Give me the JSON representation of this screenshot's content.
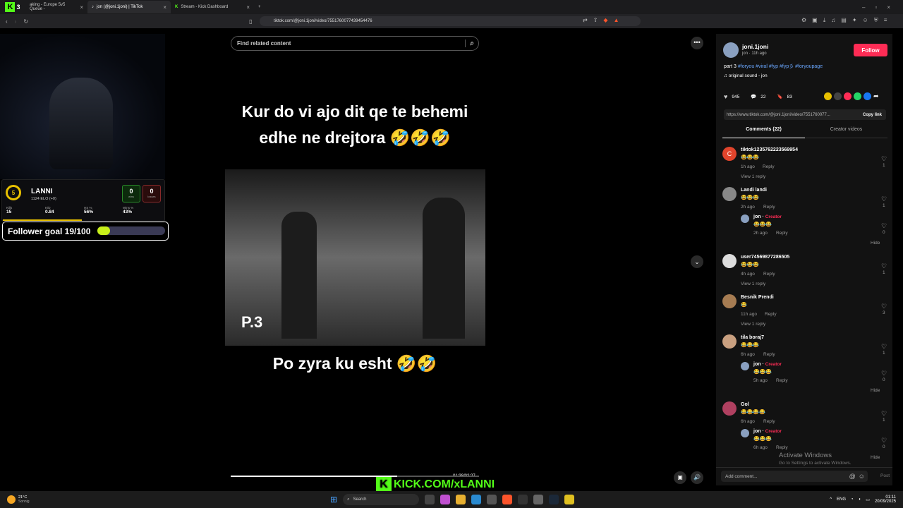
{
  "browser": {
    "tabs": [
      {
        "label": "aking - Europe 5v5 Queue -"
      },
      {
        "label": "jon (@joni.1joni) | TikTok"
      },
      {
        "label": "Stream - Kick Dashboard"
      }
    ],
    "url": "tiktok.com/@joni.1joni/video/7551760077439454476"
  },
  "overlay": {
    "level": "5",
    "player_name": "LANNI",
    "elo": "1124 ELO (+0)",
    "wins": "0",
    "wins_label": "wins",
    "losses": "0",
    "losses_label": "losses",
    "stats": [
      {
        "label": "Kills",
        "value": "15"
      },
      {
        "label": "K/D",
        "value": "0.84"
      },
      {
        "label": "HS %",
        "value": "56%"
      },
      {
        "label": "Wins %",
        "value": "43%"
      }
    ],
    "follower_goal": "Follower goal 19/100",
    "follower_progress": 0.19,
    "kick_url": "KICK.COM/xLANNI"
  },
  "video": {
    "search_placeholder": "Find related content",
    "caption1": "Kur do vi ajo dit qe te behemi edhe ne drejtora 🤣🤣🤣",
    "part": "P.3",
    "caption2": "Po zyra ku esht 🤣🤣",
    "time": "01:38/02:27",
    "progress": 0.67
  },
  "post": {
    "username": "joni.1joni",
    "subtitle": "jon · 11h ago",
    "follow": "Follow",
    "description": "part 3",
    "hashtags": "#foryou #viral #fyp #fyp彡 #foryoupage",
    "sound": "original sound - jon",
    "likes": "945",
    "comments": "22",
    "saves": "83",
    "link": "https://www.tiktok.com/@joni.1joni/video/7551760077...",
    "copy_link": "Copy link",
    "tab_comments": "Comments (22)",
    "tab_creator": "Creator videos",
    "add_comment": "Add comment...",
    "post_btn": "Post"
  },
  "comments": [
    {
      "name": "tiktok12357622235699​54",
      "emoji": "😂😂😂",
      "time": "1h ago",
      "likes": "1",
      "replies": "View 1 reply",
      "avatar": "#e0442c",
      "initial": "C"
    },
    {
      "name": "Landi landi",
      "emoji": "😂😂😂",
      "time": "2h ago",
      "likes": "1",
      "avatar": "#888",
      "initial": ""
    },
    {
      "name": "user74569877286505",
      "emoji": "😂😂😂",
      "time": "4h ago",
      "likes": "1",
      "replies": "View 1 reply",
      "avatar": "#ddd",
      "initial": ""
    },
    {
      "name": "Besnik Prendi",
      "emoji": "😂",
      "time": "11h ago",
      "likes": "3",
      "replies": "View 1 reply",
      "avatar": "#a67c52",
      "initial": ""
    },
    {
      "name": "tila boraj7",
      "emoji": "😂😂😂",
      "time": "6h ago",
      "likes": "1",
      "avatar": "#c9a080",
      "initial": ""
    },
    {
      "name": "Gol",
      "emoji": "😂😂😂😂",
      "time": "6h ago",
      "likes": "1",
      "avatar": "#b04060",
      "initial": ""
    }
  ],
  "replies": [
    {
      "name": "jon",
      "tag": "Creator",
      "emoji": "😂😂😂",
      "time": "2h ago",
      "likes": "0"
    },
    {
      "name": "jon",
      "tag": "Creator",
      "emoji": "😂😂😂",
      "time": "5h ago",
      "likes": "0"
    },
    {
      "name": "jon",
      "tag": "Creator",
      "emoji": "😂😂😂",
      "time": "6h ago",
      "likes": "0"
    }
  ],
  "labels": {
    "reply": "Reply",
    "hide": "Hide"
  },
  "windows": {
    "activate_title": "Activate Windows",
    "activate_sub": "Go to Settings to activate Windows.",
    "search": "Search",
    "weather_temp": "21°C",
    "weather_desc": "Sonnig",
    "lang": "ENG",
    "time": "01:11",
    "date": "20/09/2025"
  },
  "tab_badge": "3"
}
